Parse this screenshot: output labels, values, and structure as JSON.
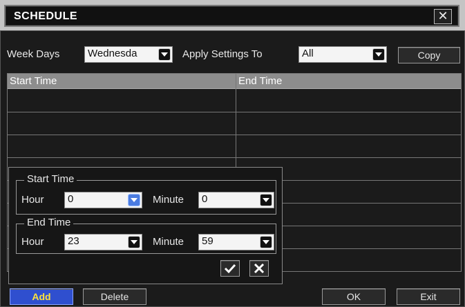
{
  "window": {
    "title": "SCHEDULE",
    "close_label": "✕"
  },
  "toolbar": {
    "week_days_label": "Week Days",
    "week_days_value": "Wednesda",
    "apply_label": "Apply Settings To",
    "apply_value": "All",
    "copy_label": "Copy"
  },
  "table": {
    "columns": [
      "Start Time",
      "End Time"
    ],
    "row_count": 8
  },
  "popup": {
    "start": {
      "legend": "Start Time",
      "hour_label": "Hour",
      "hour_value": "0",
      "minute_label": "Minute",
      "minute_value": "0"
    },
    "end": {
      "legend": "End Time",
      "hour_label": "Hour",
      "hour_value": "23",
      "minute_label": "Minute",
      "minute_value": "59"
    },
    "ok_icon": "check-icon",
    "cancel_icon": "close-icon"
  },
  "buttons": {
    "add": "Add",
    "delete": "Delete",
    "ok": "OK",
    "exit": "Exit"
  },
  "colors": {
    "add_bg": "#2f4fcf",
    "add_text": "#ffe23a",
    "header_bg": "#8d8d8d"
  }
}
